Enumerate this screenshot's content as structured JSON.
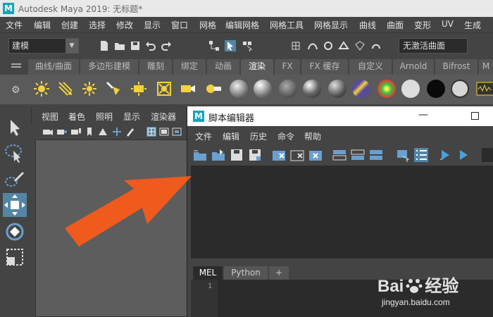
{
  "window": {
    "app_title": "Autodesk Maya 2019: 无标题*"
  },
  "menubar": {
    "items": [
      "文件",
      "编辑",
      "创建",
      "选择",
      "修改",
      "显示",
      "窗口",
      "网格",
      "编辑网格",
      "网格工具",
      "网格显示",
      "曲线",
      "曲面",
      "变形",
      "UV",
      "生成"
    ]
  },
  "status_line": {
    "mode": "建模",
    "live_surface": "无激活曲面"
  },
  "shelf": {
    "tabs": [
      "曲线/曲面",
      "多边形建模",
      "雕刻",
      "绑定",
      "动画",
      "渲染",
      "FX",
      "FX 缓存",
      "自定义",
      "Arnold",
      "Bifrost",
      "M"
    ],
    "active_tab": "渲染"
  },
  "viewport_panel": {
    "menu": [
      "视图",
      "着色",
      "照明",
      "显示",
      "渲染器"
    ]
  },
  "script_editor": {
    "title": "脚本编辑器",
    "menu": [
      "文件",
      "编辑",
      "历史",
      "命令",
      "帮助"
    ],
    "tabs": [
      "MEL",
      "Python",
      "+"
    ],
    "active_tab": "MEL",
    "line_number": "1"
  },
  "watermark": {
    "brand": "Bai",
    "brand_suffix": "经验",
    "url": "jingyan.baidu.com"
  },
  "colors": {
    "accent": "#5285a6",
    "annotation_arrow": "#f05a1c",
    "maya_logo": "#16a5b8"
  }
}
